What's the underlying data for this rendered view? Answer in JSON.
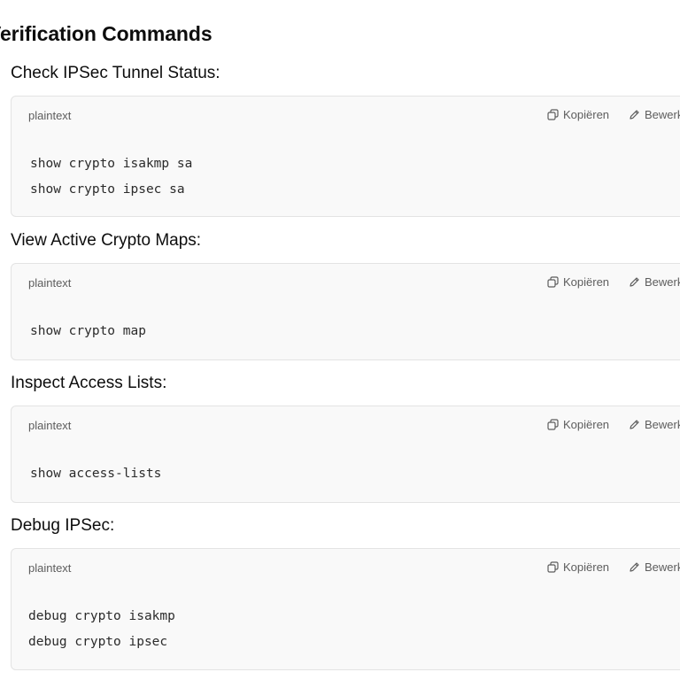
{
  "section_title": "Verification Commands",
  "blocks": [
    {
      "heading": "Check IPSec Tunnel Status:",
      "language": "plaintext",
      "copy_label": "Kopiëren",
      "edit_label": "Bewerken",
      "lines": [
        "show crypto isakmp sa",
        "show crypto ipsec sa"
      ]
    },
    {
      "heading": "View Active Crypto Maps:",
      "language": "plaintext",
      "copy_label": "Kopiëren",
      "edit_label": "Bewerken",
      "lines": [
        "show crypto map"
      ]
    },
    {
      "heading": "Inspect Access Lists:",
      "language": "plaintext",
      "copy_label": "Kopiëren",
      "edit_label": "Bewerken",
      "lines": [
        "show access-lists"
      ]
    },
    {
      "heading": "Debug IPSec:",
      "language": "plaintext",
      "copy_label": "Kopiëren",
      "edit_label": "Bewerken",
      "lines": [
        "debug crypto isakmp",
        "debug crypto ipsec"
      ]
    }
  ],
  "icons": {
    "copy": "copy-icon",
    "edit": "pencil-icon"
  }
}
